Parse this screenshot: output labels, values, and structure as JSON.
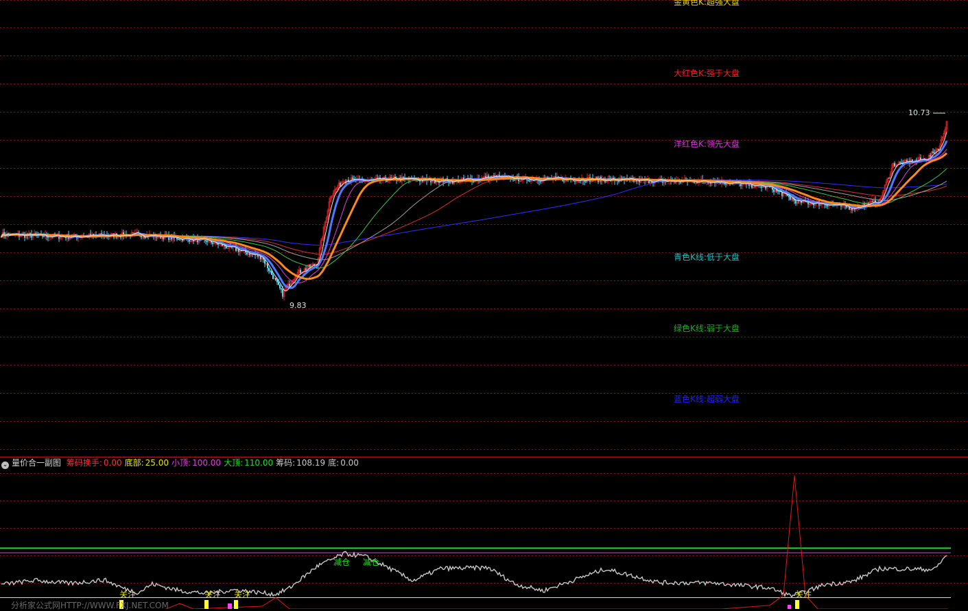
{
  "colors": {
    "grid": "#8a1010",
    "divider": "#b0141c",
    "bull": "#e02020",
    "bear": "#54e0ff",
    "ma_orange": "#ff8a1c",
    "ma_blue": "#4d7cff",
    "ma_white": "#e8e8e8",
    "ma_magenta": "#e040e0",
    "ma_green": "#3cc84a",
    "ma_red": "#d83030",
    "ma_navy": "#3030ff",
    "ma_grey": "#a0a0a0",
    "ind_line": "#c8c8c8",
    "ind_red": "#e01818",
    "ind_green": "#20e020",
    "ind_magenta": "#d050d0",
    "ind_yellow": "#e8e870"
  },
  "legend": [
    {
      "text": "金黄色K:超强大盘",
      "color": "#e8d000"
    },
    {
      "text": "大红色K:强于大盘",
      "color": "#ff2020"
    },
    {
      "text": "洋红色K:领先大盘",
      "color": "#e030e0"
    },
    {
      "text": "青色K线:低于大盘",
      "color": "#20c0c0"
    },
    {
      "text": "绿色K线:弱于大盘",
      "color": "#20b020"
    },
    {
      "text": "蓝色K线:超弱大盘",
      "color": "#2020ff"
    }
  ],
  "main_chart": {
    "price_high_label": "10.73",
    "price_low_label": "9.83",
    "price_high": 10.73,
    "price_low": 9.83
  },
  "indicator": {
    "name": "量价合一副图",
    "params": [
      {
        "label": "筹码换手:",
        "value": "0.00",
        "color": "#ff3030"
      },
      {
        "label": "底部:",
        "value": "25.00",
        "color": "#e8e800"
      },
      {
        "label": "小顶:",
        "value": "100.00",
        "color": "#e040e0"
      },
      {
        "label": "大顶:",
        "value": "110.00",
        "color": "#20e020"
      },
      {
        "label": "筹码:",
        "value": "108.19",
        "color": "#c8c8c8"
      },
      {
        "label": "底:",
        "value": "0.00",
        "color": "#c8c8c8"
      }
    ],
    "signals": [
      {
        "text": "关注",
        "color": "#e8e800",
        "x": 8
      },
      {
        "text": "关注",
        "color": "#e8e800",
        "x": 69
      },
      {
        "text": "关注",
        "color": "#e8e800",
        "x": 90
      },
      {
        "text": "减仓",
        "color": "#20e020",
        "x": 250
      },
      {
        "text": "减仓",
        "color": "#20e020",
        "x": 270
      },
      {
        "text": "关注",
        "color": "#e8e800",
        "x": 593
      }
    ]
  },
  "watermark": "分析家公式网HTTP://WWW.FXJ.NET.COM",
  "chart_data": {
    "type": "candlestick",
    "series": [
      {
        "name": "price_close",
        "x_count": 690,
        "keypoints": [
          [
            0,
            10.16
          ],
          [
            50,
            10.15
          ],
          [
            100,
            10.16
          ],
          [
            150,
            10.13
          ],
          [
            190,
            10.05
          ],
          [
            205,
            9.87
          ],
          [
            215,
            9.97
          ],
          [
            230,
            10.02
          ],
          [
            240,
            10.35
          ],
          [
            250,
            10.43
          ],
          [
            260,
            10.42
          ],
          [
            290,
            10.43
          ],
          [
            330,
            10.42
          ],
          [
            360,
            10.44
          ],
          [
            380,
            10.43
          ],
          [
            420,
            10.43
          ],
          [
            480,
            10.42
          ],
          [
            520,
            10.42
          ],
          [
            560,
            10.39
          ],
          [
            580,
            10.32
          ],
          [
            600,
            10.31
          ],
          [
            620,
            10.29
          ],
          [
            640,
            10.32
          ],
          [
            650,
            10.5
          ],
          [
            660,
            10.51
          ],
          [
            675,
            10.53
          ],
          [
            684,
            10.59
          ],
          [
            690,
            10.73
          ]
        ]
      },
      {
        "name": "indicator_value",
        "keypoints": [
          [
            0,
            30
          ],
          [
            25,
            39
          ],
          [
            50,
            32
          ],
          [
            75,
            40
          ],
          [
            90,
            20
          ],
          [
            100,
            12
          ],
          [
            110,
            31
          ],
          [
            130,
            16
          ],
          [
            150,
            10
          ],
          [
            170,
            18
          ],
          [
            200,
            8
          ],
          [
            210,
            22
          ],
          [
            230,
            70
          ],
          [
            250,
            98
          ],
          [
            265,
            92
          ],
          [
            280,
            70
          ],
          [
            300,
            38
          ],
          [
            320,
            65
          ],
          [
            355,
            67
          ],
          [
            375,
            30
          ],
          [
            395,
            16
          ],
          [
            440,
            64
          ],
          [
            480,
            34
          ],
          [
            520,
            33
          ],
          [
            560,
            22
          ],
          [
            575,
            5
          ],
          [
            585,
            12
          ],
          [
            600,
            30
          ],
          [
            620,
            36
          ],
          [
            640,
            65
          ],
          [
            680,
            63
          ],
          [
            690,
            98
          ]
        ]
      }
    ],
    "lines": {
      "大顶": 110,
      "小顶": 100,
      "底部": 25
    },
    "ylim_price": [
      9.8,
      10.8
    ]
  }
}
